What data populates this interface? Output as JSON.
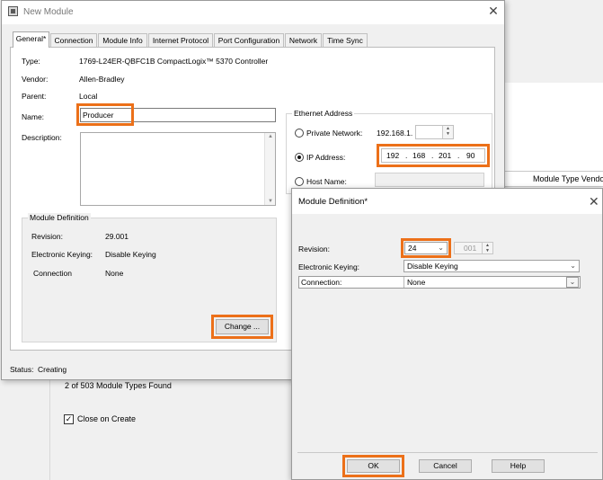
{
  "background_dialog": {
    "column_header": "Module Type Vendo",
    "found_text": "2 of 503 Module Types Found",
    "close_on_create_label": "Close on Create",
    "close_on_create_mark": "✓"
  },
  "new_module": {
    "title": "New Module",
    "close_glyph": "✕",
    "tabs": [
      {
        "label": "General*"
      },
      {
        "label": "Connection"
      },
      {
        "label": "Module Info"
      },
      {
        "label": "Internet Protocol"
      },
      {
        "label": "Port Configuration"
      },
      {
        "label": "Network"
      },
      {
        "label": "Time Sync"
      }
    ],
    "active_tab": "General*",
    "fields": {
      "type_label": "Type:",
      "type_value": "1769-L24ER-QBFC1B CompactLogix™ 5370 Controller",
      "vendor_label": "Vendor:",
      "vendor_value": "Allen-Bradley",
      "parent_label": "Parent:",
      "parent_value": "Local",
      "name_label": "Name:",
      "name_value": "Producer",
      "description_label": "Description:",
      "description_value": ""
    },
    "module_definition": {
      "title": "Module Definition",
      "revision_label": "Revision:",
      "revision_value": "29.001",
      "keying_label": "Electronic Keying:",
      "keying_value": "Disable Keying",
      "connection_label": "Connection",
      "connection_value": "None",
      "change_button": "Change ..."
    },
    "ethernet": {
      "title": "Ethernet Address",
      "private_network_label": "Private Network:",
      "private_network_prefix": "192.168.1.",
      "ip_address_label": "IP Address:",
      "ip_address_option_selected": true,
      "ip_octets": [
        "192",
        "168",
        "201",
        "90"
      ],
      "ip_separator": ".",
      "host_name_label": "Host Name:"
    },
    "status_label": "Status:",
    "status_value": "Creating"
  },
  "module_definition_dialog": {
    "title": "Module Definition*",
    "close_glyph": "✕",
    "revision_label": "Revision:",
    "revision_major": "24",
    "revision_minor": "001",
    "keying_label": "Electronic Keying:",
    "keying_value": "Disable Keying",
    "connection_label": "Connection:",
    "connection_value": "None",
    "ok_button": "OK",
    "cancel_button": "Cancel",
    "help_button": "Help"
  },
  "colors": {
    "highlight": "#ec7019",
    "window_bg": "#f0f0f0",
    "panel_bg": "#ffffff"
  }
}
